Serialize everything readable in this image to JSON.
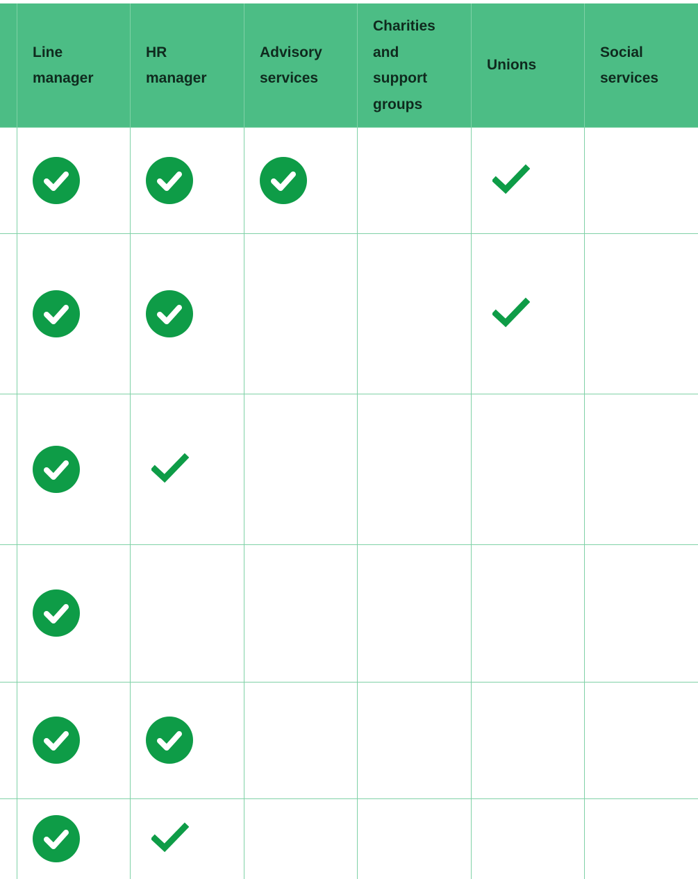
{
  "colors": {
    "header_bg": "#4cbd85",
    "header_text": "#0f2a1e",
    "grid_line": "#7fd1a6",
    "check_green": "#0e9c47"
  },
  "columns": [
    {
      "key": "line_manager",
      "label": "Line\nmanager"
    },
    {
      "key": "hr_manager",
      "label": "HR\nmanager"
    },
    {
      "key": "advisory_services",
      "label": "Advisory\nservices"
    },
    {
      "key": "charities",
      "label": "Charities\nand\nsupport\ngroups"
    },
    {
      "key": "unions",
      "label": "Unions"
    },
    {
      "key": "social_services",
      "label": "Social\nservices"
    }
  ],
  "rows": [
    {
      "cells": [
        "circle-check",
        "circle-check",
        "circle-check",
        "",
        "tick",
        ""
      ]
    },
    {
      "cells": [
        "circle-check",
        "circle-check",
        "",
        "",
        "tick",
        ""
      ]
    },
    {
      "cells": [
        "circle-check",
        "tick",
        "",
        "",
        "",
        ""
      ]
    },
    {
      "cells": [
        "circle-check",
        "",
        "",
        "",
        "",
        ""
      ]
    },
    {
      "cells": [
        "circle-check",
        "circle-check",
        "",
        "",
        "",
        ""
      ]
    },
    {
      "cells": [
        "circle-check",
        "tick",
        "",
        "",
        "",
        ""
      ]
    }
  ]
}
